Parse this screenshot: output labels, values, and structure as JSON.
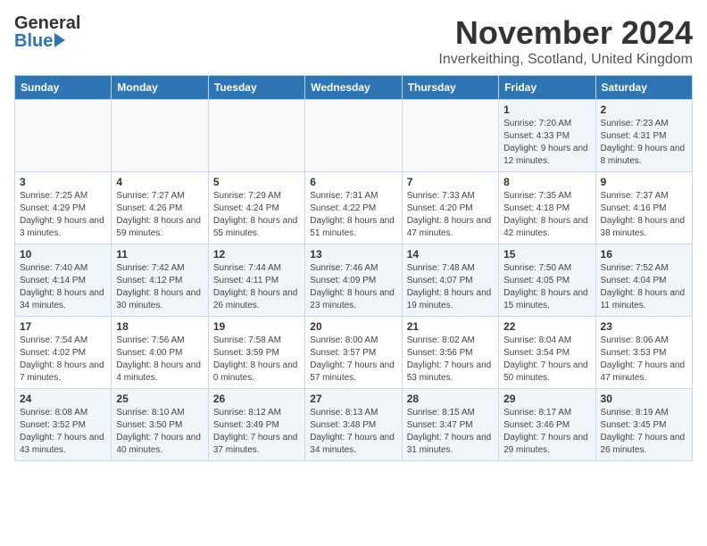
{
  "logo": {
    "general": "General",
    "blue": "Blue"
  },
  "title": "November 2024",
  "location": "Inverkeithing, Scotland, United Kingdom",
  "days_of_week": [
    "Sunday",
    "Monday",
    "Tuesday",
    "Wednesday",
    "Thursday",
    "Friday",
    "Saturday"
  ],
  "weeks": [
    [
      {
        "day": "",
        "info": ""
      },
      {
        "day": "",
        "info": ""
      },
      {
        "day": "",
        "info": ""
      },
      {
        "day": "",
        "info": ""
      },
      {
        "day": "",
        "info": ""
      },
      {
        "day": "1",
        "info": "Sunrise: 7:20 AM\nSunset: 4:33 PM\nDaylight: 9 hours and 12 minutes."
      },
      {
        "day": "2",
        "info": "Sunrise: 7:23 AM\nSunset: 4:31 PM\nDaylight: 9 hours and 8 minutes."
      }
    ],
    [
      {
        "day": "3",
        "info": "Sunrise: 7:25 AM\nSunset: 4:29 PM\nDaylight: 9 hours and 3 minutes."
      },
      {
        "day": "4",
        "info": "Sunrise: 7:27 AM\nSunset: 4:26 PM\nDaylight: 8 hours and 59 minutes."
      },
      {
        "day": "5",
        "info": "Sunrise: 7:29 AM\nSunset: 4:24 PM\nDaylight: 8 hours and 55 minutes."
      },
      {
        "day": "6",
        "info": "Sunrise: 7:31 AM\nSunset: 4:22 PM\nDaylight: 8 hours and 51 minutes."
      },
      {
        "day": "7",
        "info": "Sunrise: 7:33 AM\nSunset: 4:20 PM\nDaylight: 8 hours and 47 minutes."
      },
      {
        "day": "8",
        "info": "Sunrise: 7:35 AM\nSunset: 4:18 PM\nDaylight: 8 hours and 42 minutes."
      },
      {
        "day": "9",
        "info": "Sunrise: 7:37 AM\nSunset: 4:16 PM\nDaylight: 8 hours and 38 minutes."
      }
    ],
    [
      {
        "day": "10",
        "info": "Sunrise: 7:40 AM\nSunset: 4:14 PM\nDaylight: 8 hours and 34 minutes."
      },
      {
        "day": "11",
        "info": "Sunrise: 7:42 AM\nSunset: 4:12 PM\nDaylight: 8 hours and 30 minutes."
      },
      {
        "day": "12",
        "info": "Sunrise: 7:44 AM\nSunset: 4:11 PM\nDaylight: 8 hours and 26 minutes."
      },
      {
        "day": "13",
        "info": "Sunrise: 7:46 AM\nSunset: 4:09 PM\nDaylight: 8 hours and 23 minutes."
      },
      {
        "day": "14",
        "info": "Sunrise: 7:48 AM\nSunset: 4:07 PM\nDaylight: 8 hours and 19 minutes."
      },
      {
        "day": "15",
        "info": "Sunrise: 7:50 AM\nSunset: 4:05 PM\nDaylight: 8 hours and 15 minutes."
      },
      {
        "day": "16",
        "info": "Sunrise: 7:52 AM\nSunset: 4:04 PM\nDaylight: 8 hours and 11 minutes."
      }
    ],
    [
      {
        "day": "17",
        "info": "Sunrise: 7:54 AM\nSunset: 4:02 PM\nDaylight: 8 hours and 7 minutes."
      },
      {
        "day": "18",
        "info": "Sunrise: 7:56 AM\nSunset: 4:00 PM\nDaylight: 8 hours and 4 minutes."
      },
      {
        "day": "19",
        "info": "Sunrise: 7:58 AM\nSunset: 3:59 PM\nDaylight: 8 hours and 0 minutes."
      },
      {
        "day": "20",
        "info": "Sunrise: 8:00 AM\nSunset: 3:57 PM\nDaylight: 7 hours and 57 minutes."
      },
      {
        "day": "21",
        "info": "Sunrise: 8:02 AM\nSunset: 3:56 PM\nDaylight: 7 hours and 53 minutes."
      },
      {
        "day": "22",
        "info": "Sunrise: 8:04 AM\nSunset: 3:54 PM\nDaylight: 7 hours and 50 minutes."
      },
      {
        "day": "23",
        "info": "Sunrise: 8:06 AM\nSunset: 3:53 PM\nDaylight: 7 hours and 47 minutes."
      }
    ],
    [
      {
        "day": "24",
        "info": "Sunrise: 8:08 AM\nSunset: 3:52 PM\nDaylight: 7 hours and 43 minutes."
      },
      {
        "day": "25",
        "info": "Sunrise: 8:10 AM\nSunset: 3:50 PM\nDaylight: 7 hours and 40 minutes."
      },
      {
        "day": "26",
        "info": "Sunrise: 8:12 AM\nSunset: 3:49 PM\nDaylight: 7 hours and 37 minutes."
      },
      {
        "day": "27",
        "info": "Sunrise: 8:13 AM\nSunset: 3:48 PM\nDaylight: 7 hours and 34 minutes."
      },
      {
        "day": "28",
        "info": "Sunrise: 8:15 AM\nSunset: 3:47 PM\nDaylight: 7 hours and 31 minutes."
      },
      {
        "day": "29",
        "info": "Sunrise: 8:17 AM\nSunset: 3:46 PM\nDaylight: 7 hours and 29 minutes."
      },
      {
        "day": "30",
        "info": "Sunrise: 8:19 AM\nSunset: 3:45 PM\nDaylight: 7 hours and 26 minutes."
      }
    ]
  ]
}
